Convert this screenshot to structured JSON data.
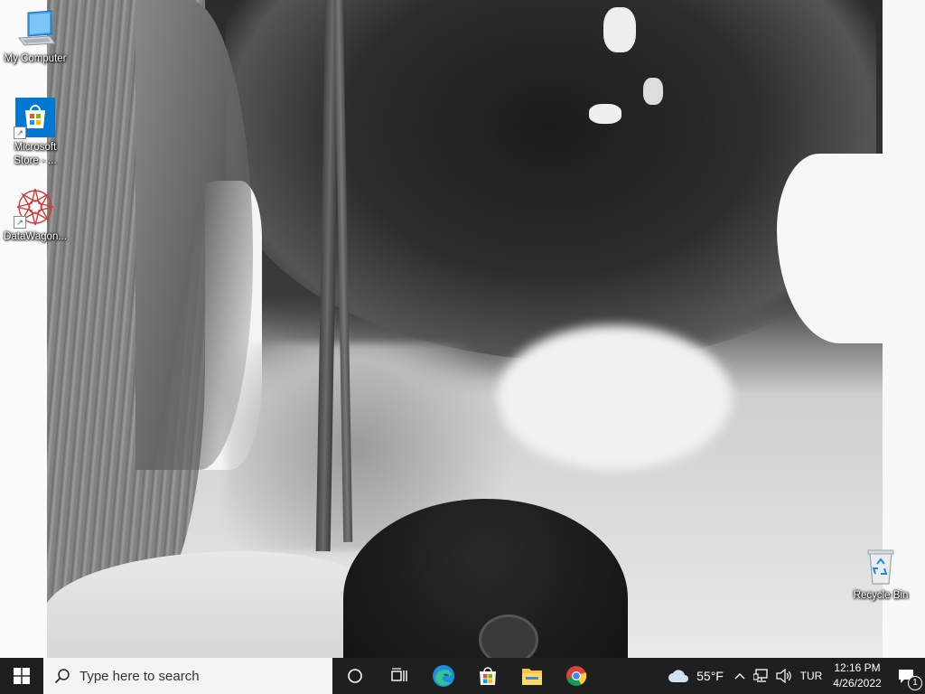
{
  "desktop": {
    "icons": [
      {
        "label": "My Computer",
        "icon": "computer-icon"
      },
      {
        "label": "Microsoft Store - ...",
        "icon": "microsoft-store-icon"
      },
      {
        "label": "DataWagon...",
        "icon": "datawagon-icon"
      },
      {
        "label": "Recycle Bin",
        "icon": "recycle-bin-icon"
      }
    ]
  },
  "taskbar": {
    "search_placeholder": "Type here to search",
    "pinned_apps": [
      "cortana-icon",
      "task-view-icon",
      "edge-icon",
      "store-icon",
      "file-explorer-icon",
      "chrome-icon"
    ],
    "weather": {
      "temp": "55°F",
      "icon": "cloud-icon"
    },
    "language": "TUR",
    "clock": {
      "time": "12:16 PM",
      "date": "4/26/2022"
    },
    "notifications_count": "1"
  },
  "colors": {
    "taskbar_bg": "#1f1f1f",
    "search_bg": "#f3f3f3",
    "accent": "#0078d4"
  }
}
